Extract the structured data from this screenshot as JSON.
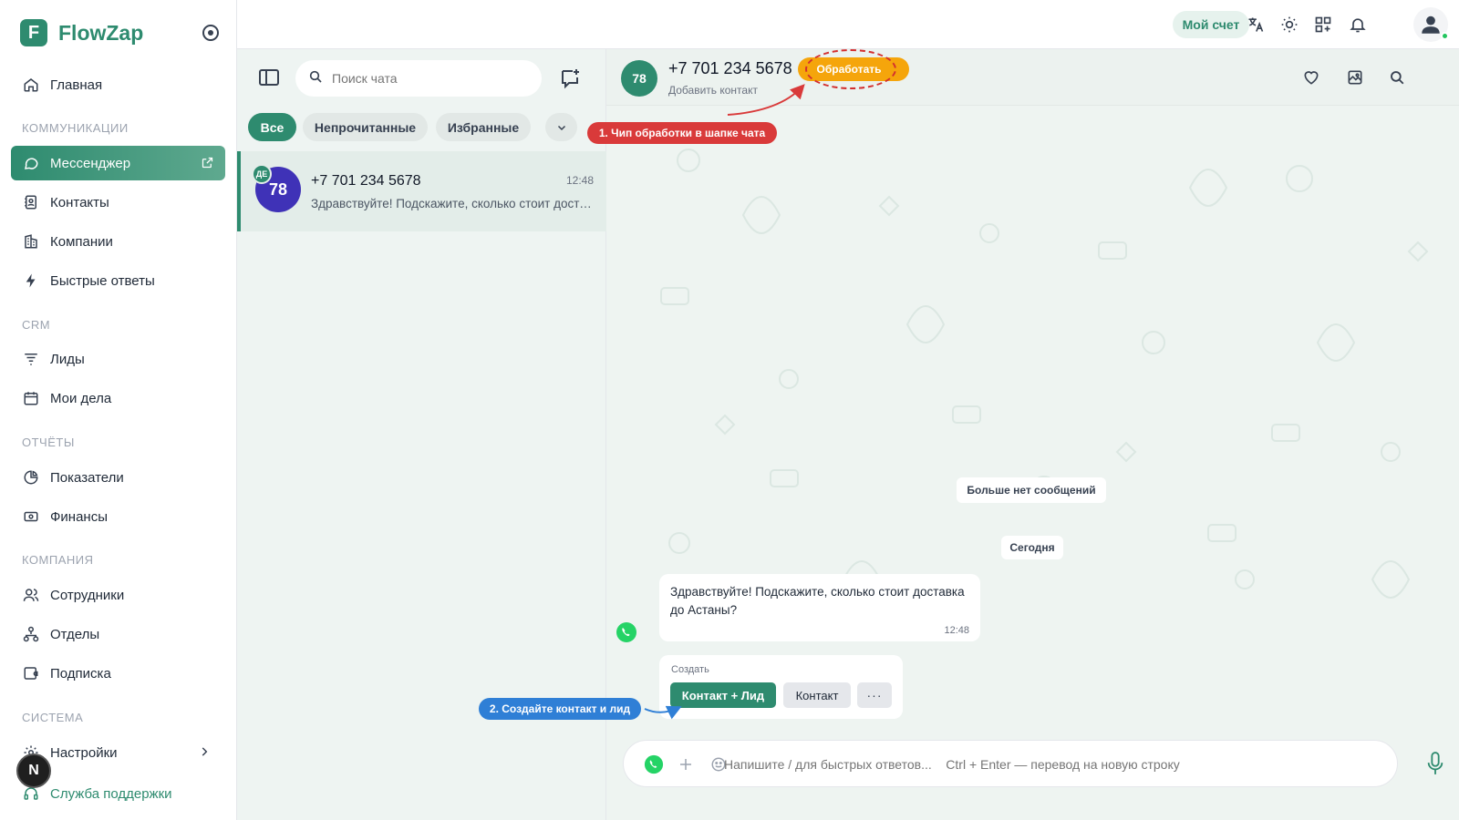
{
  "app": {
    "name": "FlowZap",
    "logo_letter": "F"
  },
  "sidebar": {
    "home": "Главная",
    "sections": {
      "communications": "КОММУНИКАЦИИ",
      "crm": "CRM",
      "reports": "ОТЧЁТЫ",
      "company": "КОМПАНИЯ",
      "system": "СИСТЕМА"
    },
    "items": {
      "messenger": "Мессенджер",
      "contacts": "Контакты",
      "companies": "Компании",
      "quick_replies": "Быстрые ответы",
      "leads": "Лиды",
      "tasks": "Мои дела",
      "metrics": "Показатели",
      "finance": "Финансы",
      "employees": "Сотрудники",
      "departments": "Отделы",
      "subscription": "Подписка",
      "settings": "Настройки",
      "support": "Служба поддержки"
    },
    "user_initial": "N"
  },
  "topbar": {
    "account_label": "Мой счет"
  },
  "chatlist": {
    "search_placeholder": "Поиск чата",
    "filters": [
      "Все",
      "Непрочитанные",
      "Избранные"
    ],
    "chats": [
      {
        "avatar": "78",
        "badge": "ДЕ",
        "name": "+7 701 234 5678",
        "time": "12:48",
        "preview": "Здравствуйте! Подскажите, сколько стоит доставка до Астаны?"
      }
    ]
  },
  "chat": {
    "avatar": "78",
    "name": "+7 701 234 5678",
    "subtitle": "Добавить контакт",
    "process_chip": "Обработать",
    "no_more_messages": "Больше нет сообщений",
    "date_divider": "Сегодня",
    "message": {
      "text": "Здравствуйте! Подскажите, сколько стоит доставка до Астаны?",
      "time": "12:48"
    },
    "create": {
      "label": "Создать",
      "contact_lead": "Контакт + Лид",
      "contact": "Контакт",
      "more": "···"
    },
    "composer_placeholder": "Напишите / для быстрых ответов...    Ctrl + Enter — перевод на новую строку"
  },
  "callouts": {
    "step1": "1. Чип обработки в шапке чата",
    "step2": "2. Создайте контакт и лид"
  },
  "colors": {
    "accent": "#2e8b6f",
    "chip": "#f5a50b",
    "callout_red": "#d93a3a",
    "callout_blue": "#2f7fd6"
  }
}
